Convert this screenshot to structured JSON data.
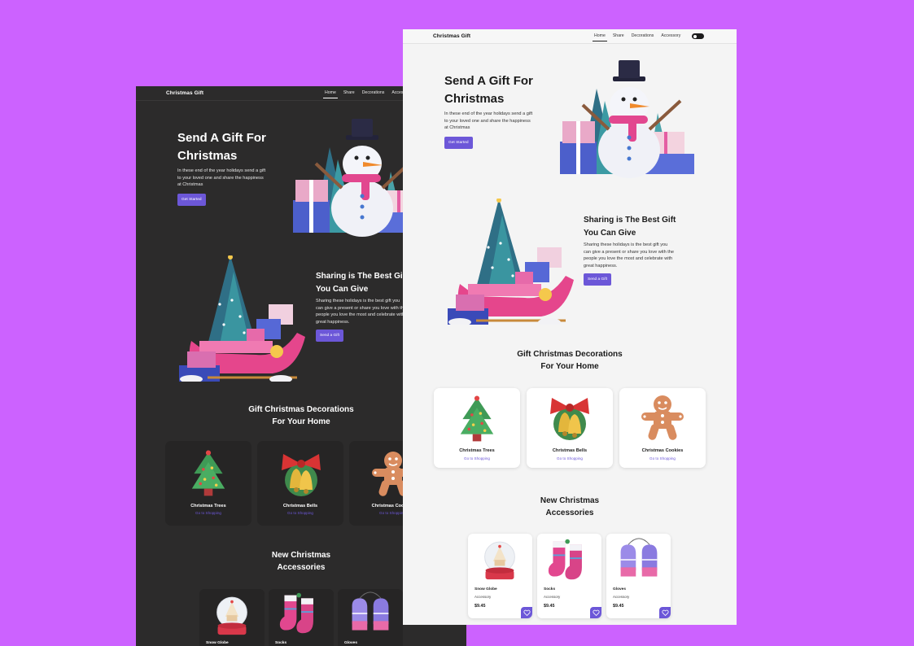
{
  "brand": "Christmas Gift",
  "nav": {
    "home": "Home",
    "share": "Share",
    "decorations": "Decorations",
    "accessory": "Accessory"
  },
  "hero": {
    "title_line1": "Send A Gift For",
    "title_line2": "Christmas",
    "description_lines": [
      "In these end of the year holidays send a gift",
      "to your loved one and share the happiness",
      "at Christmas"
    ],
    "button": "Get Started"
  },
  "share": {
    "title_line1": "Sharing is The Best Gift",
    "title_line2": "You Can Give",
    "description_lines": [
      "Sharing these holidays is the best gift you",
      "can give a present or share you love with the",
      "people you love the most and celebrate with",
      "great happiness."
    ],
    "button": "Send a Gift"
  },
  "decorations": {
    "title_line1": "Gift Christmas Decorations",
    "title_line2": "For Your Home",
    "items": [
      {
        "title": "Christmas Trees",
        "link": "Go to Shopping",
        "icon": "christmas-tree-icon"
      },
      {
        "title": "Christmas Bells",
        "link": "Go to Shopping",
        "icon": "christmas-bells-icon"
      },
      {
        "title": "Christmas Cookies",
        "link": "Go to Shopping",
        "icon": "gingerbread-cookie-icon"
      }
    ]
  },
  "accessories": {
    "title_line1": "New Christmas",
    "title_line2": "Accessories",
    "items": [
      {
        "name": "Snow Globe",
        "category": "Accessory",
        "price": "$9.45",
        "icon": "snow-globe-icon"
      },
      {
        "name": "Socks",
        "category": "Accessory",
        "price": "$9.45",
        "icon": "socks-icon"
      },
      {
        "name": "Gloves",
        "category": "Accessory",
        "price": "$9.45",
        "icon": "gloves-icon"
      }
    ]
  },
  "colors": {
    "background": "#cc62ff",
    "accent": "#6c57d8",
    "dark_bg": "#2c2b2b",
    "light_bg": "#f4f4f4"
  }
}
